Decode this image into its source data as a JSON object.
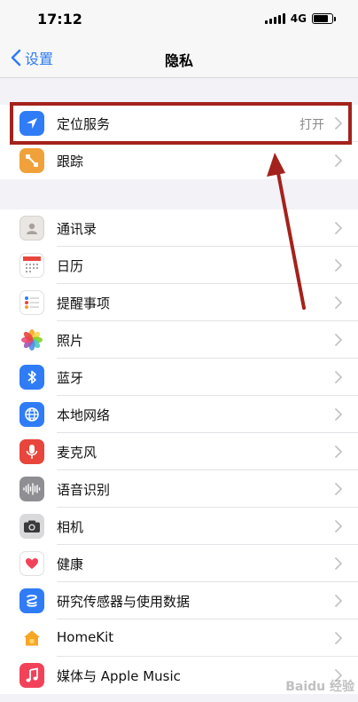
{
  "status_bar": {
    "time": "17:12",
    "network": "4G"
  },
  "nav": {
    "back_label": "设置",
    "title": "隐私"
  },
  "group1": [
    {
      "name": "location-services",
      "label": "定位服务",
      "value": "打开",
      "icon": "location-arrow-icon",
      "color": "#2f7cf6"
    },
    {
      "name": "tracking",
      "label": "跟踪",
      "icon": "tracking-icon",
      "color": "#f0a13a"
    }
  ],
  "group2": [
    {
      "name": "contacts",
      "label": "通讯录",
      "icon": "contacts-icon",
      "color": "#e9e6e3"
    },
    {
      "name": "calendar",
      "label": "日历",
      "icon": "calendar-icon",
      "color": "#ffffff"
    },
    {
      "name": "reminders",
      "label": "提醒事项",
      "icon": "reminders-icon",
      "color": "#ffffff"
    },
    {
      "name": "photos",
      "label": "照片",
      "icon": "photos-icon",
      "color": "#ffffff"
    },
    {
      "name": "bluetooth",
      "label": "蓝牙",
      "icon": "bluetooth-icon",
      "color": "#2f7cf6"
    },
    {
      "name": "local-network",
      "label": "本地网络",
      "icon": "globe-icon",
      "color": "#2f7cf6"
    },
    {
      "name": "microphone",
      "label": "麦克风",
      "icon": "microphone-icon",
      "color": "#e8453c"
    },
    {
      "name": "speech-recognition",
      "label": "语音识别",
      "icon": "waveform-icon",
      "color": "#8e8e93"
    },
    {
      "name": "camera",
      "label": "相机",
      "icon": "camera-icon",
      "color": "#5b5b5f"
    },
    {
      "name": "health",
      "label": "健康",
      "icon": "heart-icon",
      "color": "#ffffff"
    },
    {
      "name": "research",
      "label": "研究传感器与使用数据",
      "icon": "research-icon",
      "color": "#2f7cf6"
    },
    {
      "name": "homekit",
      "label": "HomeKit",
      "icon": "home-icon",
      "color": "#ffffff"
    },
    {
      "name": "apple-music",
      "label": "媒体与 Apple Music",
      "icon": "music-note-icon",
      "color": "#f2425a"
    }
  ],
  "watermark": "Baidu 经验",
  "colors": {
    "highlight": "#a4221c",
    "accent": "#2f7cf6"
  }
}
